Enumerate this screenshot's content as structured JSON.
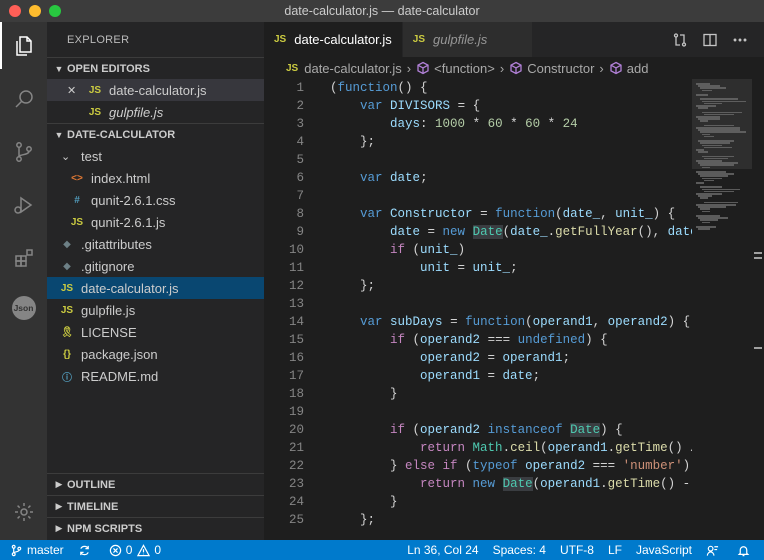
{
  "window": {
    "title": "date-calculator.js — date-calculator"
  },
  "sidebar": {
    "title": "EXPLORER",
    "open_editors": {
      "label": "OPEN EDITORS",
      "items": [
        {
          "name": "date-calculator.js",
          "icon": "JS",
          "close": "✕"
        },
        {
          "name": "gulpfile.js",
          "icon": "JS"
        }
      ]
    },
    "project": {
      "label": "DATE-CALCULATOR",
      "folder": "test",
      "folder_items": [
        {
          "name": "index.html",
          "icon": "<>"
        },
        {
          "name": "qunit-2.6.1.css",
          "icon": "#"
        },
        {
          "name": "qunit-2.6.1.js",
          "icon": "JS"
        }
      ],
      "files": [
        {
          "name": ".gitattributes",
          "icon": "◆"
        },
        {
          "name": ".gitignore",
          "icon": "◆"
        },
        {
          "name": "date-calculator.js",
          "icon": "JS"
        },
        {
          "name": "gulpfile.js",
          "icon": "JS"
        },
        {
          "name": "LICENSE",
          "icon": "🎗"
        },
        {
          "name": "package.json",
          "icon": "{}"
        },
        {
          "name": "README.md",
          "icon": "ⓘ"
        }
      ]
    },
    "outline": "OUTLINE",
    "timeline": "TIMELINE",
    "npm_scripts": "NPM SCRIPTS"
  },
  "tabs": [
    {
      "label": "date-calculator.js",
      "icon": "JS"
    },
    {
      "label": "gulpfile.js",
      "icon": "JS"
    }
  ],
  "breadcrumb": {
    "file": "date-calculator.js",
    "icon": "JS",
    "parts": [
      "<function>",
      "Constructor",
      "add"
    ]
  },
  "editor": {
    "line_numbers": [
      "1",
      "2",
      "3",
      "4",
      "5",
      "6",
      "7",
      "8",
      "9",
      "10",
      "11",
      "12",
      "13",
      "14",
      "15",
      "16",
      "17",
      "18",
      "19",
      "20",
      "21",
      "22",
      "23",
      "24",
      "25"
    ]
  },
  "activity": {
    "json_label": "Json"
  },
  "status": {
    "branch": "master",
    "errors": "0",
    "warnings": "0",
    "position": "Ln 36, Col 24",
    "spaces": "Spaces: 4",
    "encoding": "UTF-8",
    "eol": "LF",
    "language": "JavaScript"
  },
  "colors": {
    "status_bar": "#007acc",
    "selection": "#094771",
    "keyword": "#569cd6",
    "string": "#ce9178",
    "number": "#b5cea8"
  }
}
